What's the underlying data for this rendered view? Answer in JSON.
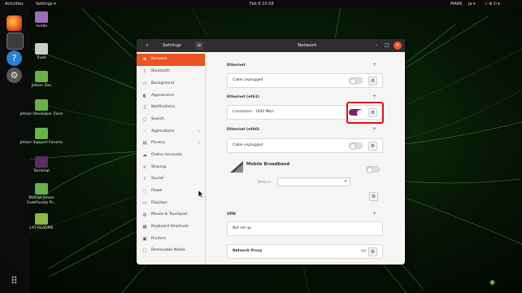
{
  "topbar": {
    "activities": "Activities",
    "app_menu": "Settings ▾",
    "clock": "Feb 6 15:58",
    "tray_left": "MARK",
    "tray_mid": "ja ▾",
    "tray_right": "⚡ ⊕ ⏻ ▾"
  },
  "desktop_icons": [
    {
      "label": "nvidia"
    },
    {
      "label": "Trash"
    },
    {
      "label": "Jetson Zoo"
    },
    {
      "label": "Jetson Developer Zone"
    },
    {
      "label": "Jetson Support Forums"
    },
    {
      "label": "Terminal"
    },
    {
      "label": "NVIDIA Jetson Community Pr..."
    },
    {
      "label": "L4T-README"
    }
  ],
  "window": {
    "sidebar_title": "Settings",
    "panel_title": "Network",
    "sidebar_items": [
      {
        "label": "Network",
        "icon": "network-icon",
        "glyph": "⊕",
        "chevron": ""
      },
      {
        "label": "Bluetooth",
        "icon": "bluetooth-icon",
        "glyph": "ᛒ",
        "chevron": ""
      },
      {
        "label": "Background",
        "icon": "background-icon",
        "glyph": "▭",
        "chevron": ""
      },
      {
        "label": "Appearance",
        "icon": "appearance-icon",
        "glyph": "◐",
        "chevron": ""
      },
      {
        "label": "Notifications",
        "icon": "bell-icon",
        "glyph": "♫",
        "chevron": ""
      },
      {
        "label": "Search",
        "icon": "search-icon",
        "glyph": "○",
        "chevron": ""
      },
      {
        "label": "Applications",
        "icon": "grid-icon",
        "glyph": "⁘",
        "chevron": "›"
      },
      {
        "label": "Privacy",
        "icon": "lock-icon",
        "glyph": "▤",
        "chevron": "›"
      },
      {
        "label": "Online Accounts",
        "icon": "cloud-icon",
        "glyph": "☁",
        "chevron": ""
      },
      {
        "label": "Sharing",
        "icon": "share-icon",
        "glyph": "≺",
        "chevron": ""
      },
      {
        "label": "Sound",
        "icon": "speaker-icon",
        "glyph": "♪",
        "chevron": ""
      },
      {
        "label": "Power",
        "icon": "power-icon",
        "glyph": "◌",
        "chevron": ""
      },
      {
        "label": "Displays",
        "icon": "display-icon",
        "glyph": "▭",
        "chevron": ""
      },
      {
        "label": "Mouse & Touchpad",
        "icon": "mouse-icon",
        "glyph": "◍",
        "chevron": ""
      },
      {
        "label": "Keyboard Shortcuts",
        "icon": "keyboard-icon",
        "glyph": "▦",
        "chevron": ""
      },
      {
        "label": "Printers",
        "icon": "printer-icon",
        "glyph": "▣",
        "chevron": ""
      },
      {
        "label": "Removable Media",
        "icon": "media-icon",
        "glyph": "▢",
        "chevron": ""
      }
    ],
    "network": {
      "ethernet": {
        "header": "Ethernet",
        "status": "Cable unplugged",
        "enabled": false
      },
      "eth1": {
        "header": "Ethernet (eth1)",
        "status": "Connected - 1000 Mb/s",
        "enabled": true
      },
      "eth0": {
        "header": "Ethernet (eth0)",
        "status": "Cable unplugged",
        "enabled": false
      },
      "mobile": {
        "title": "Mobile Broadband",
        "network_label": "Network",
        "enabled": false
      },
      "vpn": {
        "header": "VPN",
        "status": "Not set up"
      },
      "proxy": {
        "label": "Network Proxy",
        "value": "Off"
      }
    }
  },
  "colors": {
    "accent": "#e95420",
    "toggle_on": "#77216f",
    "highlight": "#e10e1b"
  }
}
